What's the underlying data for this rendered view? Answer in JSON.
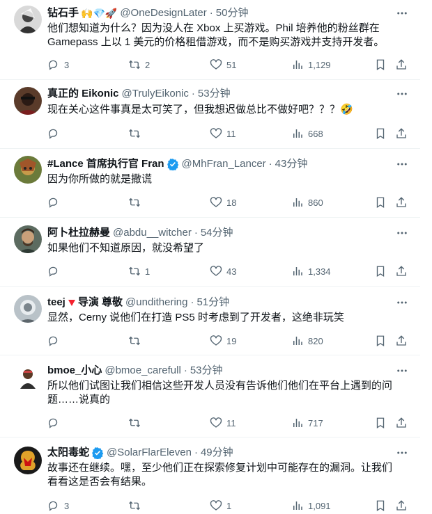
{
  "tweets": [
    {
      "name": "钻石手",
      "emoji": "🙌💎🚀",
      "verified": false,
      "handle": "@OneDesignLater",
      "time": "50分钟",
      "text": "他们想知道为什么？因为没人在 Xbox 上买游戏。Phil 培养他的粉丝群在 Gamepass 上以 1 美元的价格租借游戏，而不是购买游戏并支持开发者。",
      "replies": "3",
      "retweets": "2",
      "likes": "51",
      "views": "1,129"
    },
    {
      "name": "真正的 Eikonic",
      "emoji": "",
      "verified": false,
      "handle": "@TrulyEikonic",
      "time": "53分钟",
      "text": "现在关心这件事真是太可笑了，但我想迟做总比不做好吧？？？🤣",
      "replies": "",
      "retweets": "",
      "likes": "11",
      "views": "668"
    },
    {
      "name": "#Lance 首席执行官 Fran",
      "emoji": "",
      "verified": true,
      "handle": "@MhFran_Lancer",
      "time": "43分钟",
      "text": "因为你所做的就是撒谎",
      "replies": "",
      "retweets": "",
      "likes": "18",
      "views": "860"
    },
    {
      "name": "阿卜杜拉赫曼",
      "emoji": "",
      "verified": false,
      "handle": "@abdu__witcher",
      "time": "54分钟",
      "text": "如果他们不知道原因，就没希望了",
      "replies": "",
      "retweets": "1",
      "likes": "43",
      "views": "1,334"
    },
    {
      "name_a": "teej",
      "name_b": "导演 尊敬",
      "emoji": "",
      "verified": false,
      "handle": "@undithering",
      "time": "51分钟",
      "text": "显然，Cerny 说他们在打造 PS5 时考虑到了开发者，这绝非玩笑",
      "replies": "",
      "retweets": "",
      "likes": "19",
      "views": "820"
    },
    {
      "name": "bmoe_小心",
      "emoji": "",
      "verified": false,
      "handle": "@bmoe_carefull",
      "time": "53分钟",
      "text": "所以他们试图让我们相信这些开发人员没有告诉他们他们在平台上遇到的问题……说真的",
      "replies": "",
      "retweets": "",
      "likes": "11",
      "views": "717"
    },
    {
      "name": "太阳毒蛇",
      "emoji": "",
      "verified": true,
      "handle": "@SolarFlarEleven",
      "time": "49分钟",
      "text": "故事还在继续。嘿，至少他们正在探索修复计划中可能存在的漏洞。让我们看看这是否会有结果。",
      "replies": "3",
      "retweets": "",
      "likes": "1",
      "views": "1,091"
    }
  ],
  "separator": "·",
  "colors": {
    "text": "#0f1419",
    "secondary": "#536471",
    "verified": "#1d9bf0",
    "divider": "#eff3f4"
  }
}
